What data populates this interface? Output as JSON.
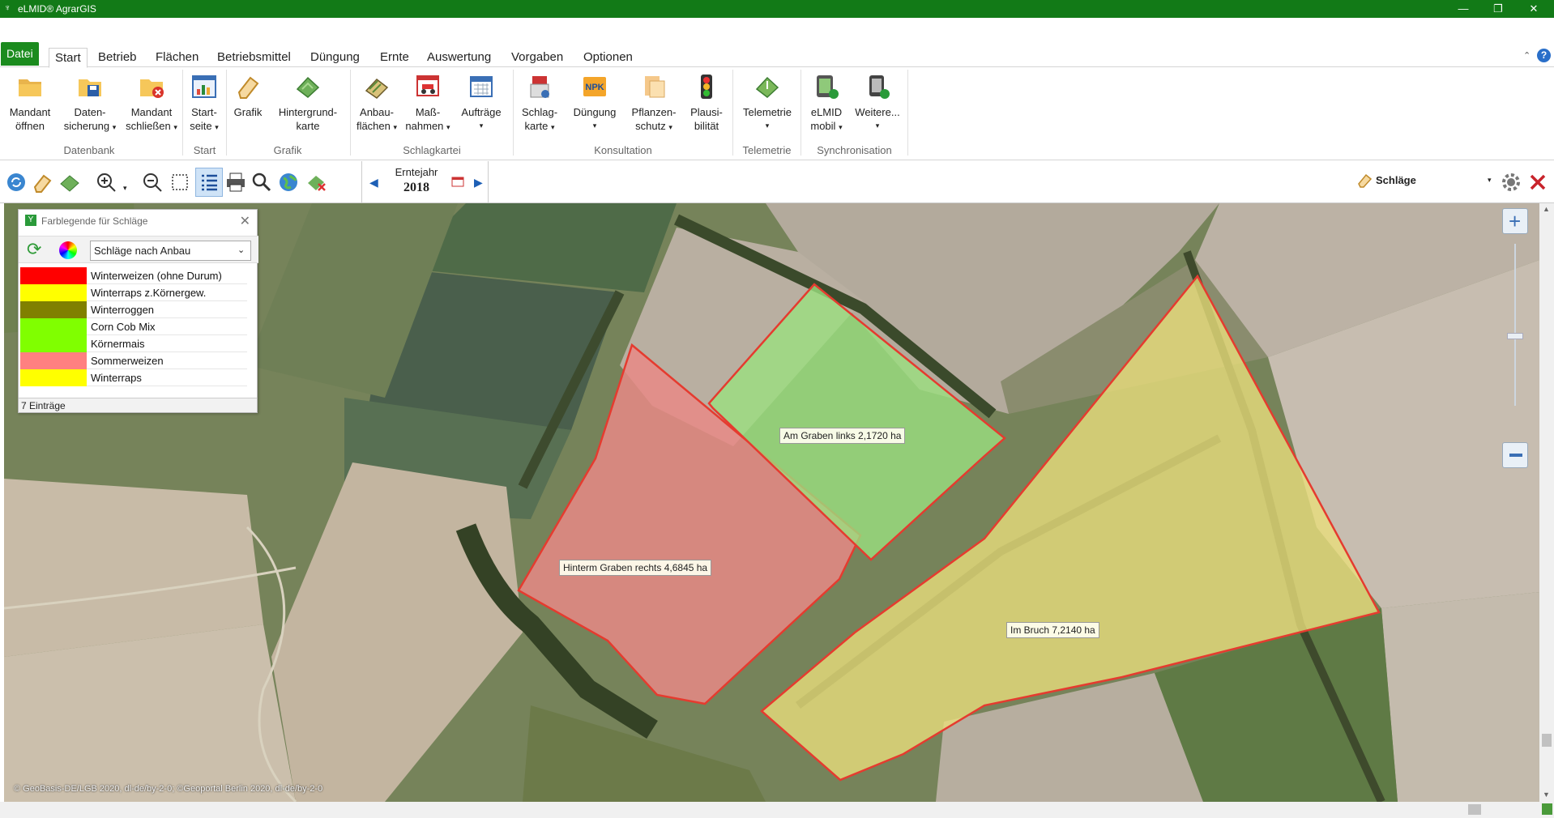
{
  "window": {
    "title": "eLMID® AgrarGIS",
    "title_color": "#127a17"
  },
  "tabs": [
    {
      "label": "Datei"
    },
    {
      "label": "Start"
    },
    {
      "label": "Betrieb"
    },
    {
      "label": "Flächen"
    },
    {
      "label": "Betriebsmittel"
    },
    {
      "label": "Düngung"
    },
    {
      "label": "Ernte"
    },
    {
      "label": "Auswertung"
    },
    {
      "label": "Vorgaben"
    },
    {
      "label": "Optionen"
    }
  ],
  "ribbon": {
    "buttons": [
      {
        "line1": "Mandant",
        "line2": "öffnen",
        "icon": "folder-open-icon"
      },
      {
        "line1": "Daten-",
        "line2": "sicherung",
        "icon": "save-icon"
      },
      {
        "line1": "Mandant",
        "line2": "schließen",
        "icon": "folder-close-icon"
      },
      {
        "line1": "Start-",
        "line2": "seite",
        "icon": "startpage-icon"
      },
      {
        "line1": "Grafik",
        "line2": "",
        "icon": "eraser-icon"
      },
      {
        "line1": "Hintergrund-",
        "line2": "karte",
        "icon": "map-icon"
      },
      {
        "line1": "Anbau-",
        "line2": "flächen",
        "icon": "fields-icon"
      },
      {
        "line1": "Maß-",
        "line2": "nahmen",
        "icon": "tractor-icon"
      },
      {
        "line1": "Aufträge",
        "line2": "",
        "icon": "calendar-icon"
      },
      {
        "line1": "Schlag-",
        "line2": "karte",
        "icon": "field-card-icon"
      },
      {
        "line1": "Düngung",
        "line2": "",
        "icon": "npk-icon"
      },
      {
        "line1": "Pflanzen-",
        "line2": "schutz",
        "icon": "plant-protection-icon"
      },
      {
        "line1": "Plausi-",
        "line2": "bilität",
        "icon": "traffic-light-icon"
      },
      {
        "line1": "Telemetrie",
        "line2": "",
        "icon": "telemetry-icon"
      },
      {
        "line1": "eLMID",
        "line2": "mobil",
        "icon": "mobile-icon"
      },
      {
        "line1": "Weitere...",
        "line2": "",
        "icon": "more-devices-icon"
      }
    ],
    "groups": [
      {
        "label": "Datenbank"
      },
      {
        "label": "Start"
      },
      {
        "label": "Grafik"
      },
      {
        "label": "Schlagkartei"
      },
      {
        "label": "Konsultation"
      },
      {
        "label": "Telemetrie"
      },
      {
        "label": "Synchronisation"
      }
    ]
  },
  "toolbar": {
    "harvest_year_label": "Erntejahr",
    "harvest_year": "2018",
    "layer_name": "Schläge"
  },
  "legend": {
    "title": "Farblegende für Schläge",
    "mode": "Schläge nach Anbau",
    "count": "7 Einträge",
    "entries": [
      {
        "label": "Winterweizen (ohne Durum)",
        "color": "#ff0000"
      },
      {
        "label": "Winterraps z.Körnergew.",
        "color": "#ffff00"
      },
      {
        "label": "Winterroggen",
        "color": "#808000"
      },
      {
        "label": "Corn Cob Mix",
        "color": "#80ff00"
      },
      {
        "label": "Körnermais",
        "color": "#80ff00"
      },
      {
        "label": "Sommerweizen",
        "color": "#ff8080"
      },
      {
        "label": "Winterraps",
        "color": "#ffff00"
      }
    ]
  },
  "map": {
    "fields": [
      {
        "label": "Am Graben links 2,1720 ha",
        "color": "#9be07f"
      },
      {
        "label": "Hinterm Graben rechts 4,6845 ha",
        "color": "#e88a86"
      },
      {
        "label": "Im Bruch 7,2140 ha",
        "color": "#e8dd7c"
      }
    ],
    "copyright": "© GeoBasis-DE/LGB 2020, dl-de/by-2-0; ©Geoportal Berlin 2020, dl-de/by-2-0"
  }
}
